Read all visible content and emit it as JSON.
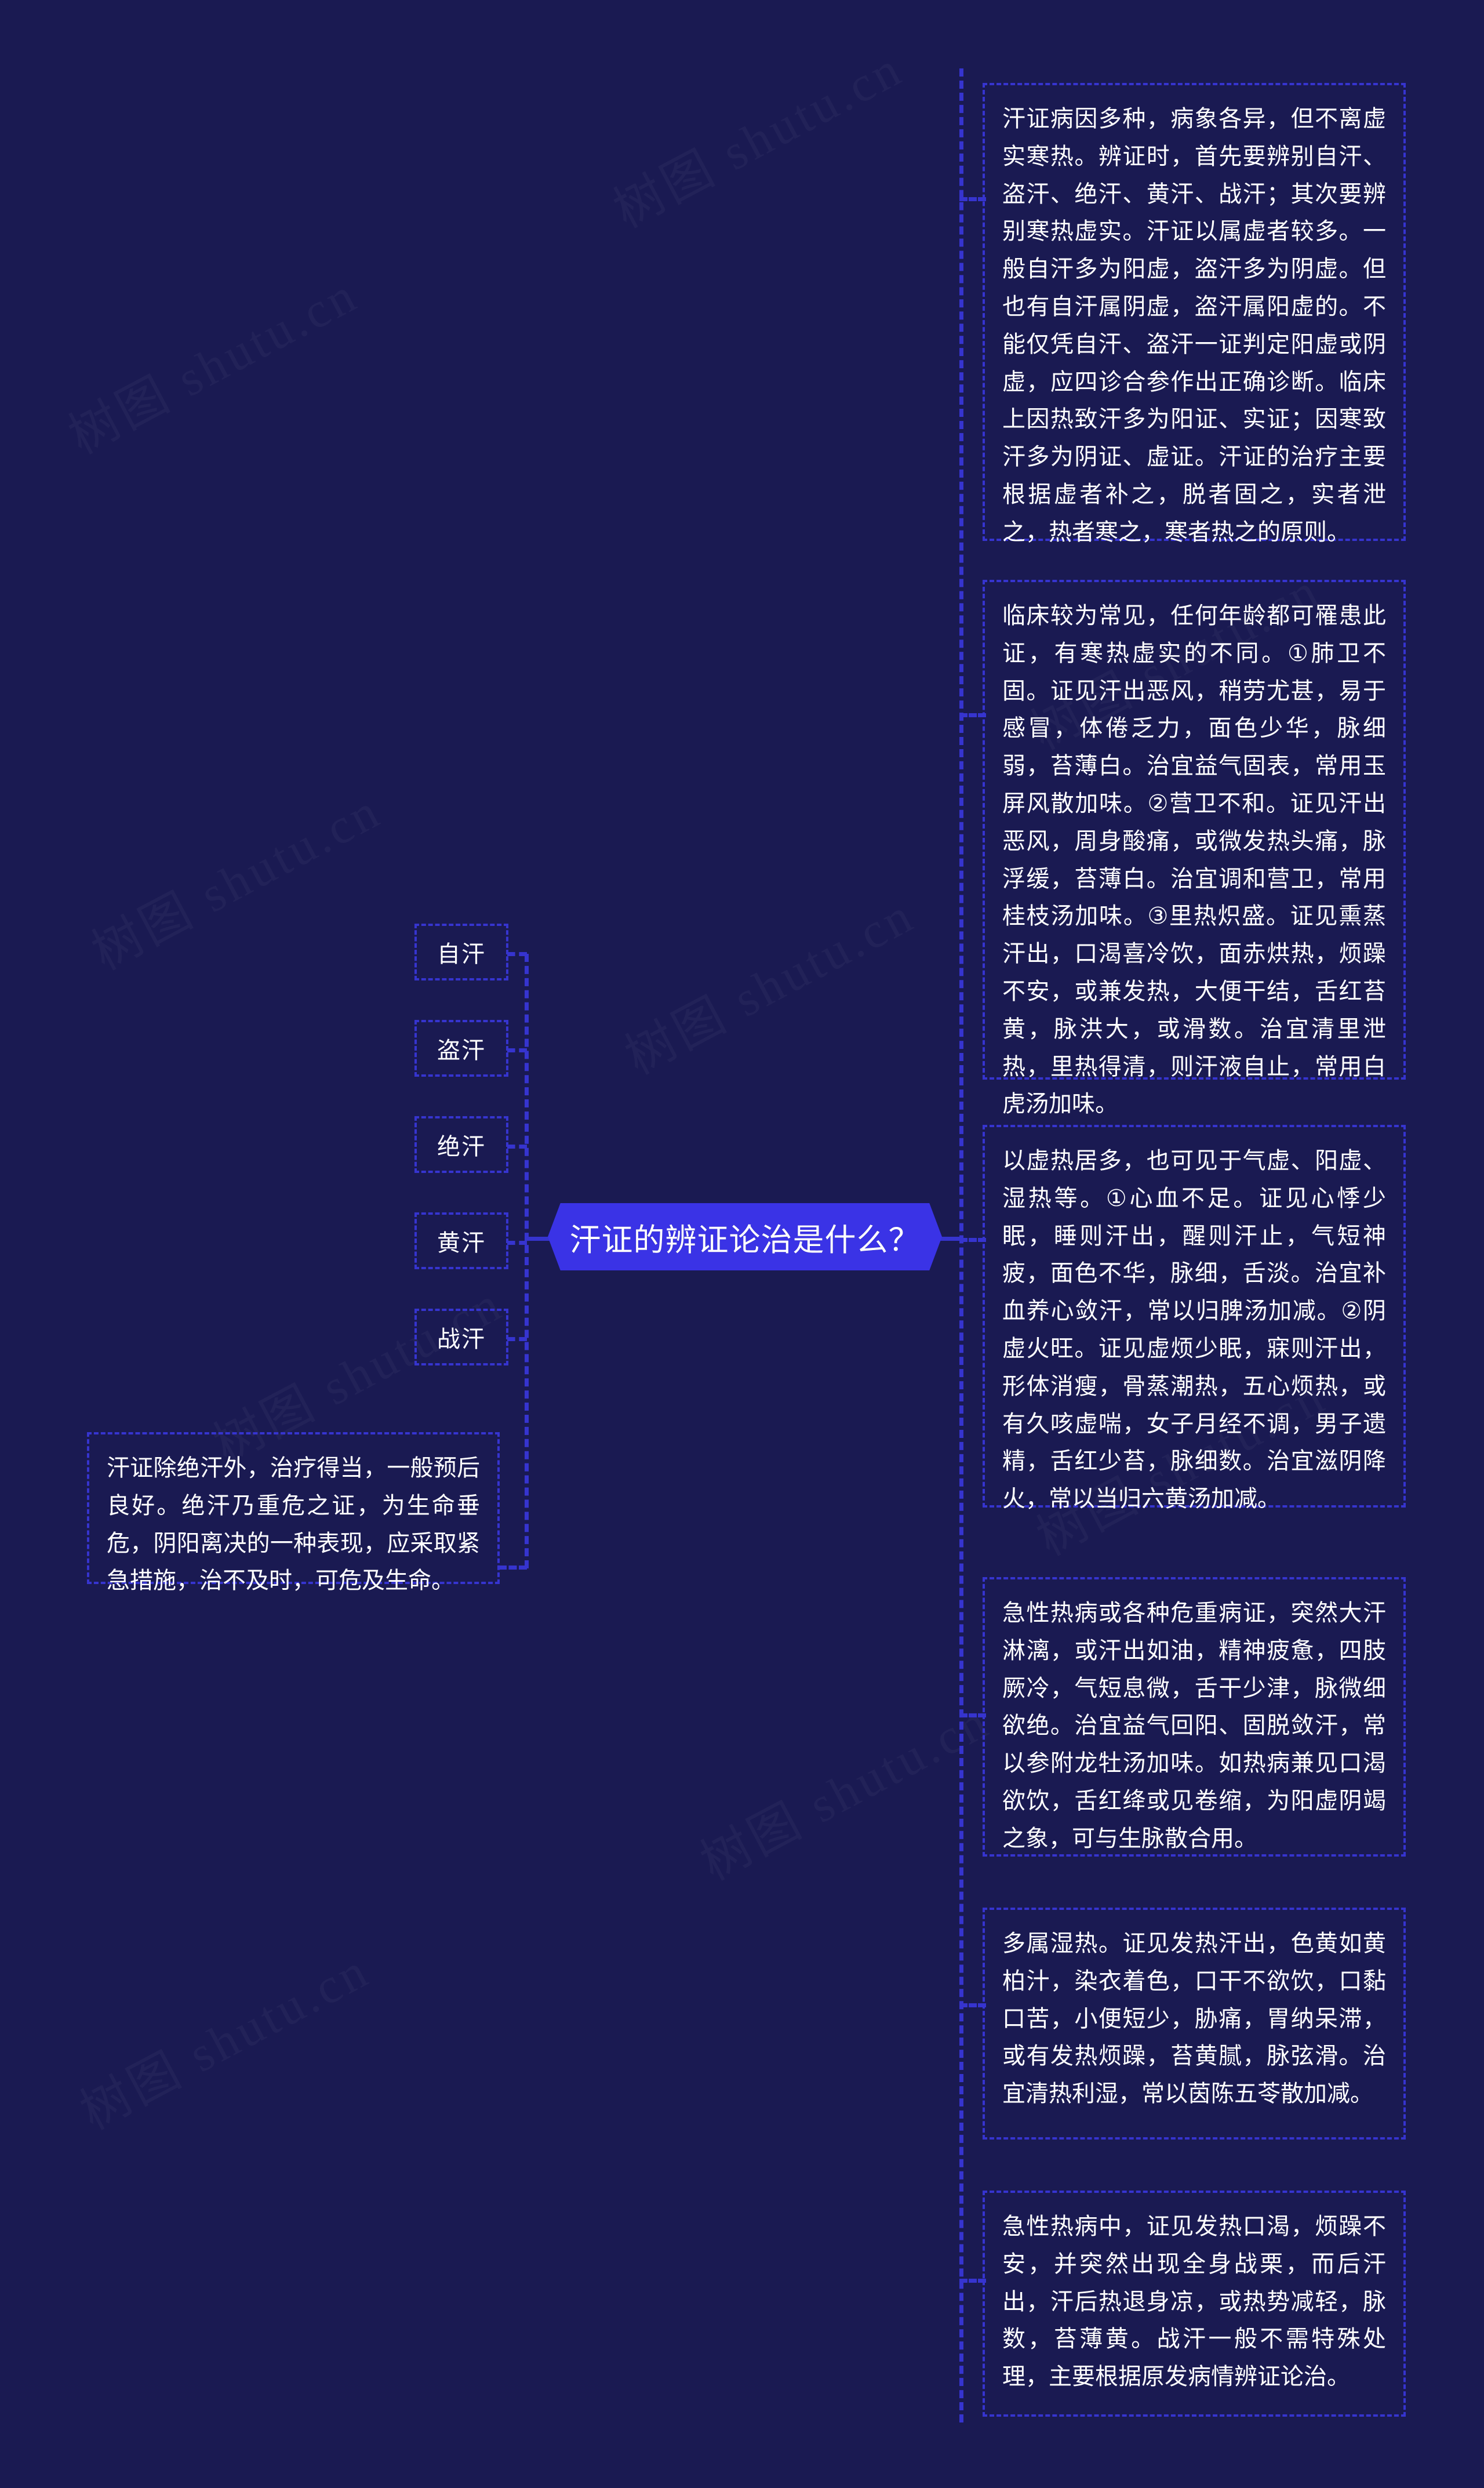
{
  "meta": {
    "title": "汗证的辨证论治是什么？",
    "watermark": "树图 shutu.cn",
    "accent_color": "#3a33e6",
    "border_color": "#3634cf",
    "background_color": "#1a1a52",
    "text_color": "#ffffff"
  },
  "center": {
    "label": "汗证的辨证论治是什么？"
  },
  "left_branch": {
    "items": [
      {
        "label": "自汗"
      },
      {
        "label": "盗汗"
      },
      {
        "label": "绝汗"
      },
      {
        "label": "黄汗"
      },
      {
        "label": "战汗"
      }
    ],
    "prognosis": {
      "text": "汗证除绝汗外，治疗得当，一般预后良好。绝汗乃重危之证，为生命垂危，阴阳离决的一种表现，应采取紧急措施，治不及时，可危及生命。"
    }
  },
  "right_branch": {
    "items": [
      {
        "text": "汗证病因多种，病象各异，但不离虚实寒热。辨证时，首先要辨别自汗、盗汗、绝汗、黄汗、战汗；其次要辨别寒热虚实。汗证以属虚者较多。一般自汗多为阳虚，盗汗多为阴虚。但也有自汗属阴虚，盗汗属阳虚的。不能仅凭自汗、盗汗一证判定阳虚或阴虚，应四诊合参作出正确诊断。临床上因热致汗多为阳证、实证；因寒致汗多为阴证、虚证。汗证的治疗主要根据虚者补之，脱者固之，实者泄之，热者寒之，寒者热之的原则。"
      },
      {
        "text": "临床较为常见，任何年龄都可罹患此证，有寒热虚实的不同。①肺卫不固。证见汗出恶风，稍劳尤甚，易于感冒，体倦乏力，面色少华，脉细弱，苔薄白。治宜益气固表，常用玉屏风散加味。②营卫不和。证见汗出恶风，周身酸痛，或微发热头痛，脉浮缓，苔薄白。治宜调和营卫，常用桂枝汤加味。③里热炽盛。证见熏蒸汗出，口渴喜冷饮，面赤烘热，烦躁不安，或兼发热，大便干结，舌红苔黄，脉洪大，或滑数。治宜清里泄热，里热得清，则汗液自止，常用白虎汤加味。"
      },
      {
        "text": "以虚热居多，也可见于气虚、阳虚、湿热等。①心血不足。证见心悸少眠，睡则汗出，醒则汗止，气短神疲，面色不华，脉细，舌淡。治宜补血养心敛汗，常以归脾汤加减。②阴虚火旺。证见虚烦少眠，寐则汗出，形体消瘦，骨蒸潮热，五心烦热，或有久咳虚喘，女子月经不调，男子遗精，舌红少苔，脉细数。治宜滋阴降火，常以当归六黄汤加减。"
      },
      {
        "text": "急性热病或各种危重病证，突然大汗淋漓，或汗出如油，精神疲惫，四肢厥冷，气短息微，舌干少津，脉微细欲绝。治宜益气回阳、固脱敛汗，常以参附龙牡汤加味。如热病兼见口渴欲饮，舌红绛或见卷缩，为阳虚阴竭之象，可与生脉散合用。"
      },
      {
        "text": "多属湿热。证见发热汗出，色黄如黄柏汁，染衣着色，口干不欲饮，口黏口苦，小便短少，胁痛，胃纳呆滞，或有发热烦躁，苔黄腻，脉弦滑。治宜清热利湿，常以茵陈五苓散加减。"
      },
      {
        "text": "急性热病中，证见发热口渴，烦躁不安，并突然出现全身战栗，而后汗出，汗后热退身凉，或热势减轻，脉数，苔薄黄。战汗一般不需特殊处理，主要根据原发病情辨证论治。"
      }
    ]
  }
}
